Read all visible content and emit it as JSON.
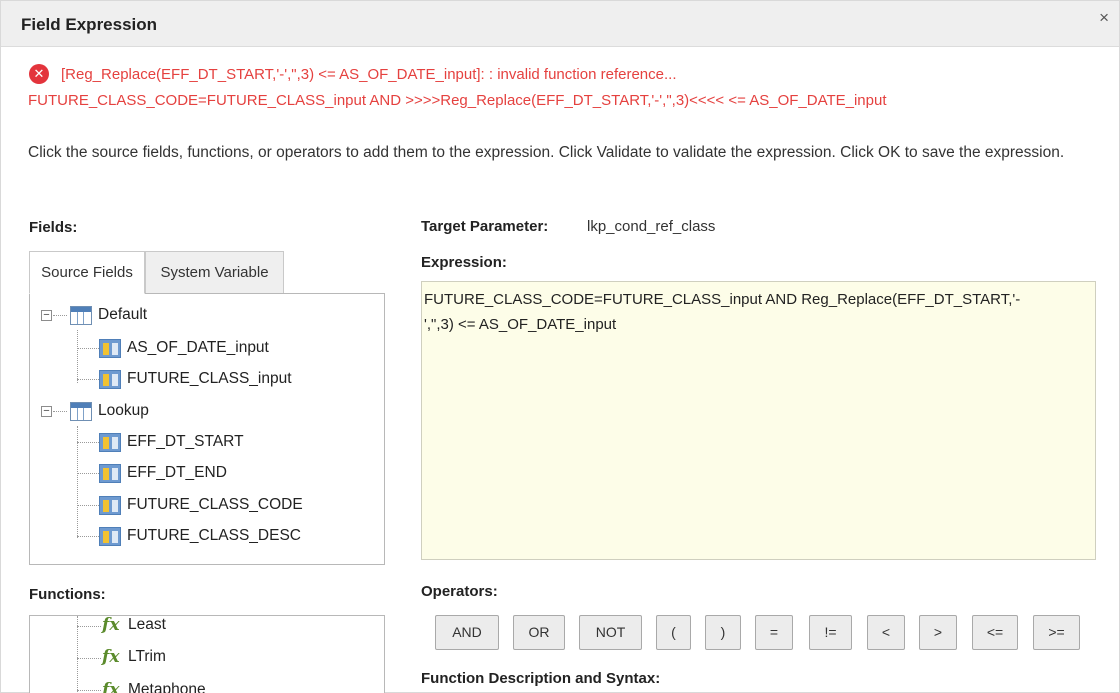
{
  "dialog": {
    "title": "Field Expression",
    "close_glyph": "×"
  },
  "error": {
    "icon_glyph": "✕",
    "line1": "[Reg_Replace(EFF_DT_START,'-',\",3) <= AS_OF_DATE_input]: : invalid function reference...",
    "line2": "FUTURE_CLASS_CODE=FUTURE_CLASS_input AND >>>>Reg_Replace(EFF_DT_START,'-',\",3)<<<< <= AS_OF_DATE_input",
    "color": "#e5413f"
  },
  "instructions": "Click the source fields, functions, or operators to add them to the expression. Click Validate to validate the expression. Click OK to save the expression.",
  "fields": {
    "label": "Fields:",
    "tabs": [
      {
        "label": "Source Fields",
        "active": true
      },
      {
        "label": "System Variable",
        "active": false
      }
    ],
    "tree": [
      {
        "label": "Default",
        "expander": "−",
        "children": [
          "AS_OF_DATE_input",
          "FUTURE_CLASS_input"
        ]
      },
      {
        "label": "Lookup",
        "expander": "−",
        "children": [
          "EFF_DT_START",
          "EFF_DT_END",
          "FUTURE_CLASS_CODE",
          "FUTURE_CLASS_DESC"
        ]
      }
    ]
  },
  "target": {
    "label": "Target Parameter:",
    "value": "lkp_cond_ref_class"
  },
  "expression": {
    "label": "Expression:",
    "line1": "FUTURE_CLASS_CODE=FUTURE_CLASS_input AND  Reg_Replace(EFF_DT_START,'-",
    "line2": "',\",3)  <=  AS_OF_DATE_input",
    "background": "#fdfde8"
  },
  "functions": {
    "label": "Functions:",
    "icon_glyph": "fx",
    "items": [
      "Least",
      "LTrim",
      "Metaphone"
    ]
  },
  "operators": {
    "label": "Operators:",
    "buttons": [
      "AND",
      "OR",
      "NOT",
      "(",
      ")",
      "=",
      "!=",
      "<",
      ">",
      "<=",
      ">="
    ]
  },
  "function_description": {
    "label": "Function Description and Syntax:"
  }
}
